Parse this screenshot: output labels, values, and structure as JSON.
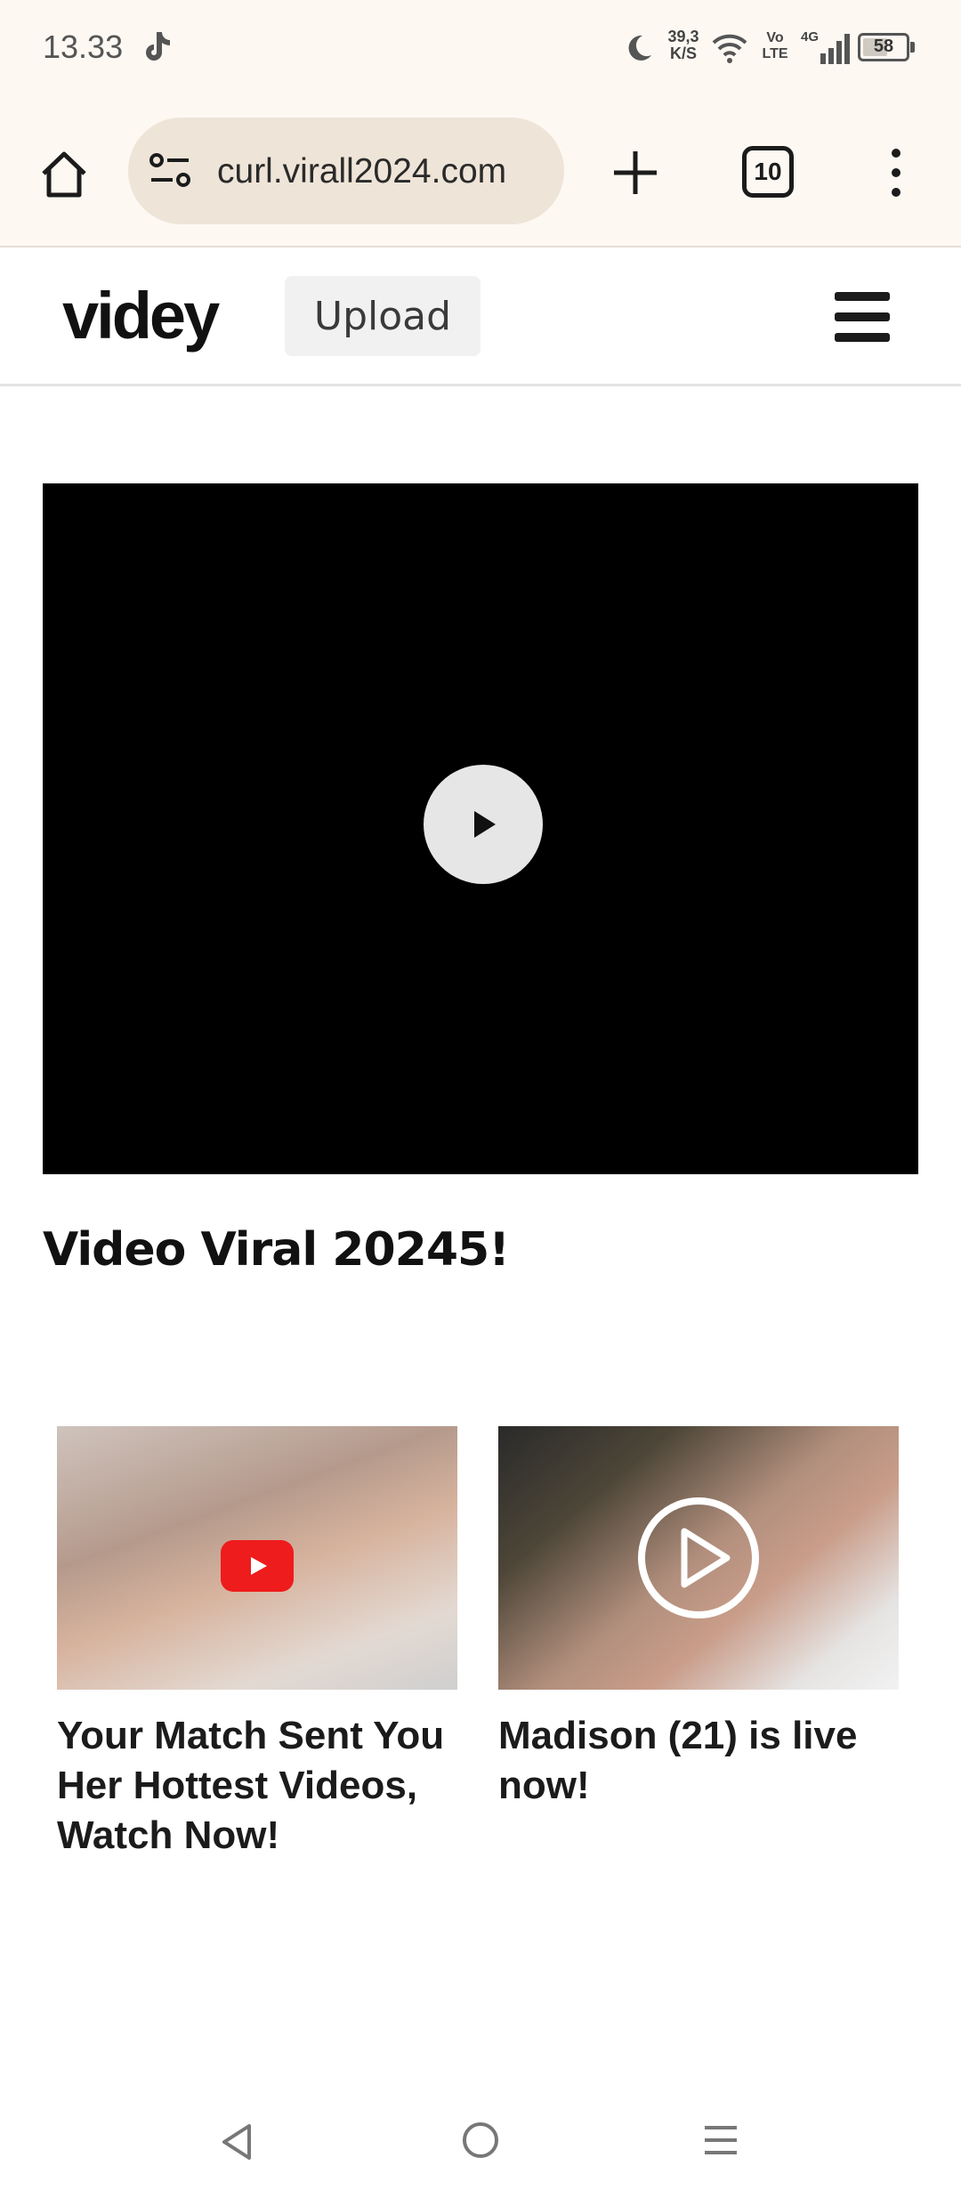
{
  "status_bar": {
    "time": "13.33",
    "net_speed_value": "39,3",
    "net_speed_unit": "K/S",
    "volte_top": "Vo",
    "volte_bottom": "LTE",
    "network": "4G",
    "battery": "58",
    "battery_level": 0.58
  },
  "browser": {
    "url": "curl.virall2024.com",
    "tab_count": "10"
  },
  "site": {
    "logo": "videy",
    "upload_label": "Upload"
  },
  "video": {
    "title": "Video Viral 20245!"
  },
  "ads": [
    {
      "caption": "Your Match Sent You Her Hottest Videos, Watch Now!"
    },
    {
      "caption": "Madison (21) is live now!"
    }
  ]
}
